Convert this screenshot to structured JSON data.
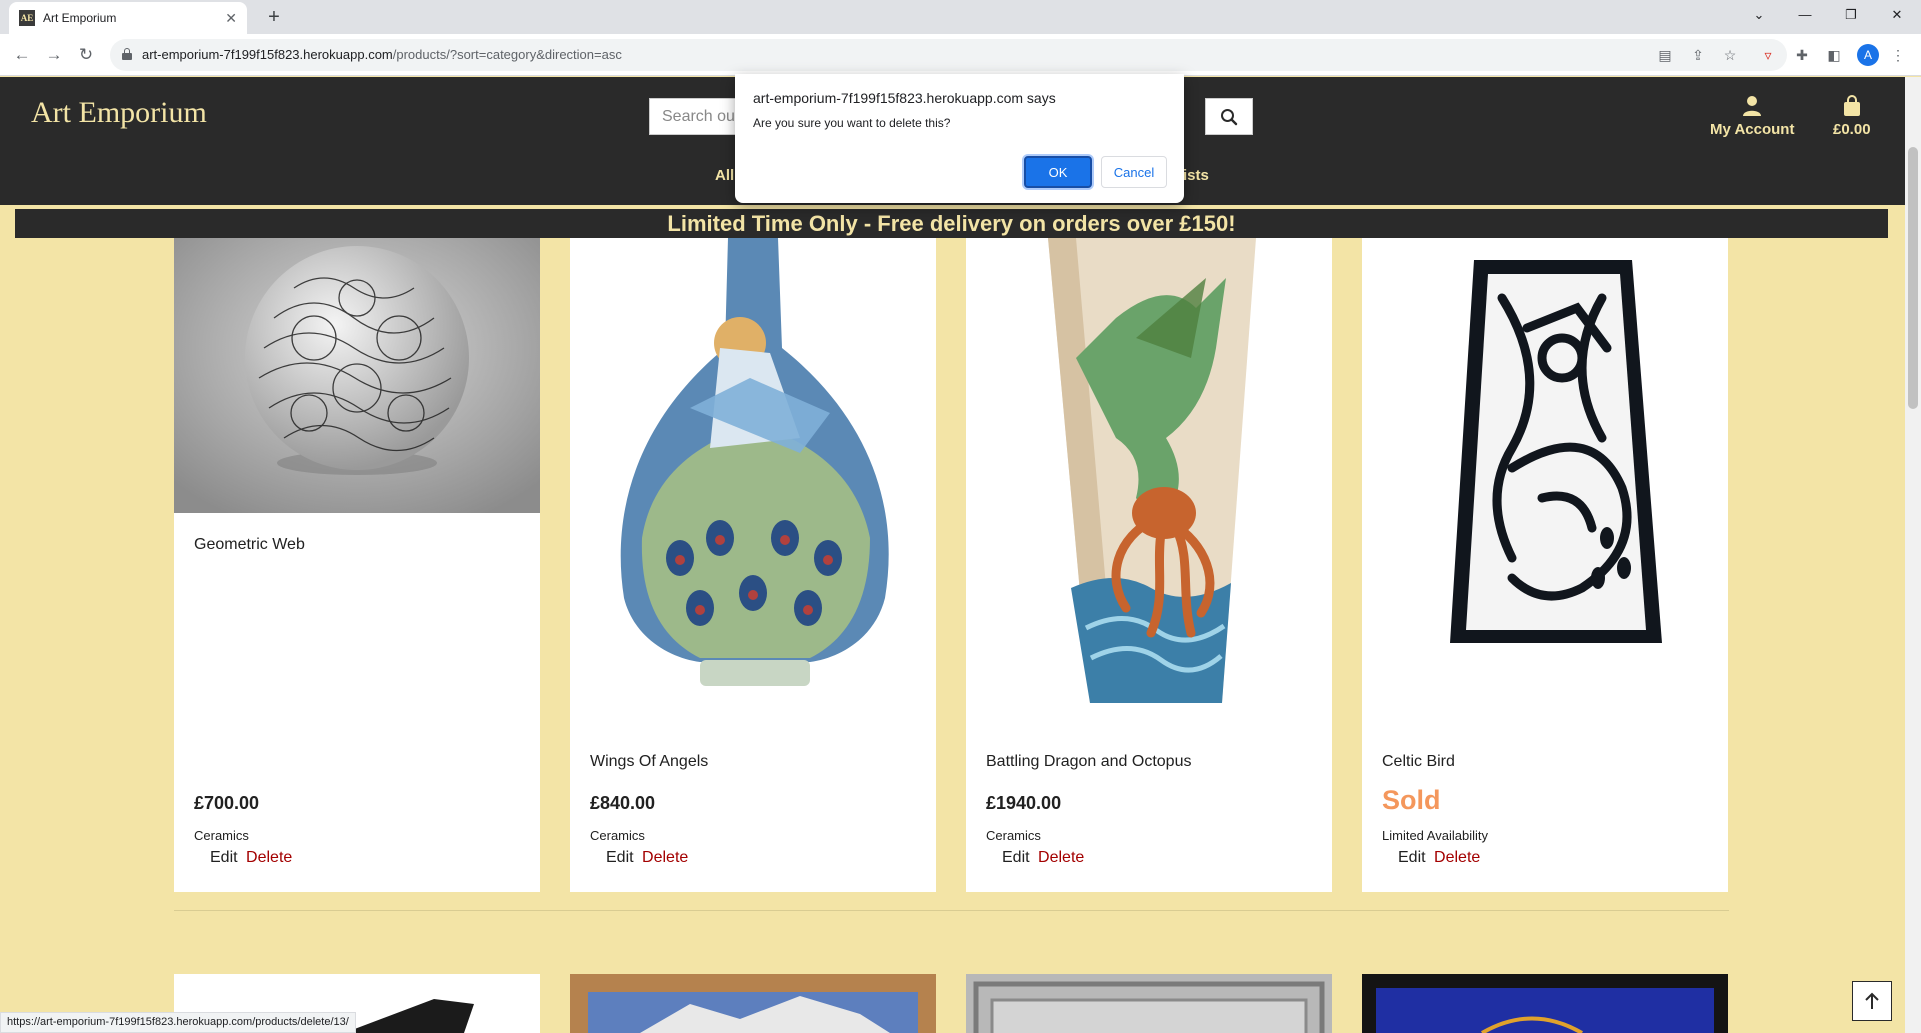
{
  "browser": {
    "tab_title": "Art Emporium",
    "favicon_text": "AE",
    "url_host": "art-emporium-7f199f15f823.herokuapp.com",
    "url_path": "/products/?sort=category&direction=asc",
    "profile_initial": "A",
    "status_url": "https://art-emporium-7f199f15f823.herokuapp.com/products/delete/13/"
  },
  "header": {
    "logo": "Art Emporium",
    "search_placeholder": "Search our site",
    "account_label": "My Account",
    "bag_total": "£0.00",
    "nav_left": "All",
    "nav_right": "tists"
  },
  "banner": "Limited Time Only - Free delivery on orders over £150!",
  "dialog": {
    "title": "art-emporium-7f199f15f823.herokuapp.com says",
    "message": "Are you sure you want to delete this?",
    "ok": "OK",
    "cancel": "Cancel"
  },
  "products": [
    {
      "name": "Geometric Web",
      "price": "£700.00",
      "category": "Ceramics",
      "edit": "Edit",
      "delete": "Delete"
    },
    {
      "name": "Wings Of Angels",
      "price": "£840.00",
      "category": "Ceramics",
      "edit": "Edit",
      "delete": "Delete"
    },
    {
      "name": "Battling Dragon and Octopus",
      "price": "£1940.00",
      "category": "Ceramics",
      "edit": "Edit",
      "delete": "Delete"
    },
    {
      "name": "Celtic Bird",
      "sold": "Sold",
      "category": "Limited Availability",
      "edit": "Edit",
      "delete": "Delete"
    }
  ],
  "colors": {
    "accent": "#f3e4a6",
    "dark": "#2a2a2a",
    "delete": "#a30000",
    "sold": "#f4975c",
    "dialog_button": "#1a73e8"
  },
  "icons": [
    "search-icon",
    "user-icon",
    "shopping-bag-icon",
    "arrow-up-icon"
  ]
}
